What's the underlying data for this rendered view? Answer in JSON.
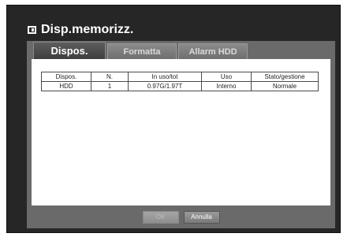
{
  "window": {
    "title": "Disp.memorizz."
  },
  "tabs": [
    {
      "label": "Dispos."
    },
    {
      "label": "Formatta"
    },
    {
      "label": "Allarm HDD"
    }
  ],
  "table": {
    "headers": [
      "Dispos.",
      "N.",
      "In uso/tot",
      "Uso",
      "Stato/gestione"
    ],
    "rows": [
      [
        "HDD",
        "1",
        "0.97G/1.97T",
        "Interno",
        "Normale"
      ]
    ]
  },
  "buttons": {
    "ok_label": "OK",
    "cancel_label": "Annulla"
  }
}
